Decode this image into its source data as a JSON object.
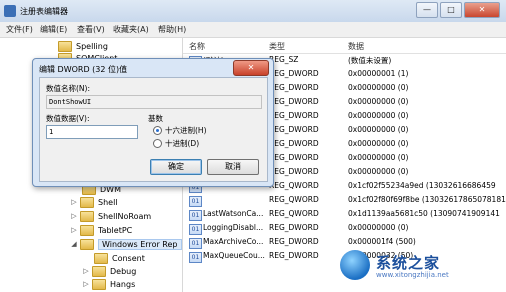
{
  "window": {
    "title": "注册表编辑器",
    "controls": [
      "—",
      "□",
      "✕"
    ]
  },
  "menubar": [
    "文件(F)",
    "编辑(E)",
    "查看(V)",
    "收藏夹(A)",
    "帮助(H)"
  ],
  "tree": {
    "items": [
      {
        "label": "Spelling"
      },
      {
        "label": "SQMClient"
      },
      {
        "label": "DWM"
      },
      {
        "label": "Shell"
      },
      {
        "label": "ShellNoRoam"
      },
      {
        "label": "TabletPC"
      },
      {
        "label": "Windows Error Rep"
      },
      {
        "label": "Consent"
      },
      {
        "label": "Debug"
      },
      {
        "label": "Hangs"
      }
    ]
  },
  "list": {
    "headers": {
      "name": "名称",
      "type": "类型",
      "data": "数据"
    },
    "rows": [
      {
        "name": "(默认)",
        "type": "REG_SZ",
        "data": "(数值未设置)"
      },
      {
        "name": "",
        "type": "REG_DWORD",
        "data": "0x00000001 (1)"
      },
      {
        "name": "",
        "type": "REG_DWORD",
        "data": "0x00000000 (0)"
      },
      {
        "name": "",
        "type": "REG_DWORD",
        "data": "0x00000000 (0)"
      },
      {
        "name": "",
        "type": "REG_DWORD",
        "data": "0x00000000 (0)"
      },
      {
        "name": "",
        "type": "REG_DWORD",
        "data": "0x00000000 (0)"
      },
      {
        "name": "",
        "type": "REG_DWORD",
        "data": "0x00000000 (0)"
      },
      {
        "name": "",
        "type": "REG_DWORD",
        "data": "0x00000000 (0)"
      },
      {
        "name": "",
        "type": "REG_DWORD",
        "data": "0x00000000 (0)"
      },
      {
        "name": "",
        "type": "REG_QWORD",
        "data": "0x1cf02f55234a9ed (13032616686459"
      },
      {
        "name": "",
        "type": "REG_QWORD",
        "data": "0x1cf02f80f69f8be (13032617865078181"
      },
      {
        "name": "LastWatsonCa...",
        "type": "REG_QWORD",
        "data": "0x1d1139aa5681c50 (13090741909141"
      },
      {
        "name": "LoggingDisabl...",
        "type": "REG_DWORD",
        "data": "0x00000000 (0)"
      },
      {
        "name": "MaxArchiveCo...",
        "type": "REG_DWORD",
        "data": "0x000001f4 (500)"
      },
      {
        "name": "MaxQueueCou...",
        "type": "REG_DWORD",
        "data": "0x00000032 (50)"
      }
    ]
  },
  "dialog": {
    "title": "编辑 DWORD (32 位)值",
    "close": "✕",
    "name_label": "数值名称(N):",
    "name_value": "DontShowUI",
    "data_label": "数值数据(V):",
    "data_value": "1",
    "base_label": "基数",
    "hex_label": "十六进制(H)",
    "dec_label": "十进制(D)",
    "ok": "确定",
    "cancel": "取消"
  },
  "watermark": {
    "text": "系统之家",
    "sub": "www.xitongzhijia.net"
  }
}
